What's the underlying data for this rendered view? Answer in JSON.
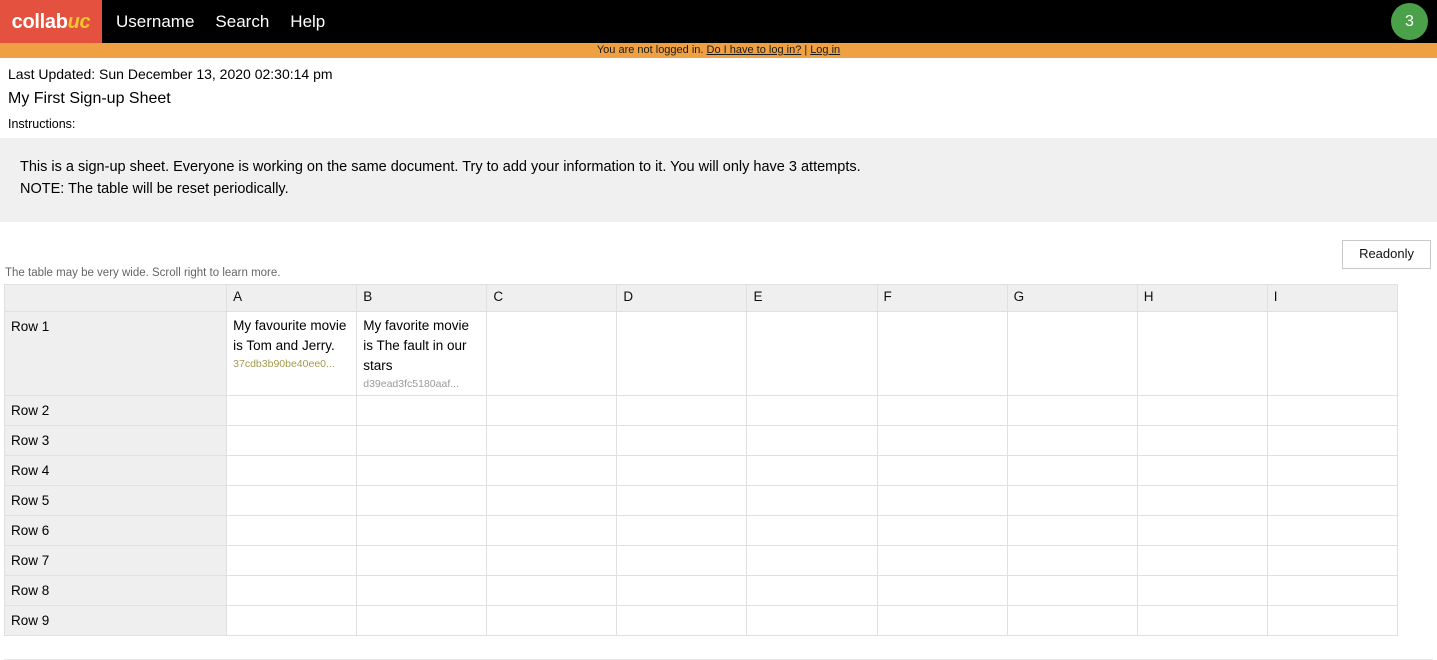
{
  "navbar": {
    "brand_primary": "collab",
    "brand_accent": "uc",
    "brand_bg": "#e4513f",
    "brand_accent_color": "#f2c430",
    "links": [
      {
        "label": "Username",
        "name": "nav-link-username"
      },
      {
        "label": "Search",
        "name": "nav-link-search"
      },
      {
        "label": "Help",
        "name": "nav-link-help"
      }
    ],
    "attempts_badge": {
      "value": "3",
      "color": "#4aa14a"
    }
  },
  "alert": {
    "message": "You are not logged in.",
    "help_link": "Do I have to log in?",
    "separator": "|",
    "login_link": "Log in",
    "background": "#efa043"
  },
  "header": {
    "last_updated": "Last Updated: Sun December 13, 2020 02:30:14 pm",
    "sheet_title": "My First Sign-up Sheet",
    "instructions_label": "Instructions:"
  },
  "instructions": {
    "line1": "This is a sign-up sheet. Everyone is working on the same document. Try to add your information to it. You will only have 3 attempts.",
    "line2": "NOTE: The table will be reset periodically."
  },
  "toolbar": {
    "readonly_label": "Readonly"
  },
  "table": {
    "scroll_hint": "The table may be very wide. Scroll right to learn more.",
    "corner_label": "",
    "columns": [
      "A",
      "B",
      "C",
      "D",
      "E",
      "F",
      "G",
      "H",
      "I"
    ],
    "rows": [
      {
        "label": "Row 1",
        "cells": [
          {
            "text": "My favourite movie is Tom and Jerry.",
            "hash": "37cdb3b90be40ee0...",
            "highlight": true
          },
          {
            "text": "My favorite movie is The fault in our stars",
            "hash": "d39ead3fc5180aaf...",
            "highlight": false
          },
          {
            "text": "",
            "hash": "",
            "highlight": false
          },
          {
            "text": "",
            "hash": "",
            "highlight": false
          },
          {
            "text": "",
            "hash": "",
            "highlight": false
          },
          {
            "text": "",
            "hash": "",
            "highlight": false
          },
          {
            "text": "",
            "hash": "",
            "highlight": false
          },
          {
            "text": "",
            "hash": "",
            "highlight": false
          },
          {
            "text": "",
            "hash": "",
            "highlight": false
          }
        ]
      },
      {
        "label": "Row 2",
        "cells": [
          {
            "text": "",
            "hash": "",
            "highlight": false
          },
          {
            "text": "",
            "hash": "",
            "highlight": false
          },
          {
            "text": "",
            "hash": "",
            "highlight": false
          },
          {
            "text": "",
            "hash": "",
            "highlight": false
          },
          {
            "text": "",
            "hash": "",
            "highlight": false
          },
          {
            "text": "",
            "hash": "",
            "highlight": false
          },
          {
            "text": "",
            "hash": "",
            "highlight": false
          },
          {
            "text": "",
            "hash": "",
            "highlight": false
          },
          {
            "text": "",
            "hash": "",
            "highlight": false
          }
        ]
      },
      {
        "label": "Row 3",
        "cells": [
          {
            "text": "",
            "hash": "",
            "highlight": false
          },
          {
            "text": "",
            "hash": "",
            "highlight": false
          },
          {
            "text": "",
            "hash": "",
            "highlight": false
          },
          {
            "text": "",
            "hash": "",
            "highlight": false
          },
          {
            "text": "",
            "hash": "",
            "highlight": false
          },
          {
            "text": "",
            "hash": "",
            "highlight": false
          },
          {
            "text": "",
            "hash": "",
            "highlight": false
          },
          {
            "text": "",
            "hash": "",
            "highlight": false
          },
          {
            "text": "",
            "hash": "",
            "highlight": false
          }
        ]
      },
      {
        "label": "Row 4",
        "cells": [
          {
            "text": "",
            "hash": "",
            "highlight": false
          },
          {
            "text": "",
            "hash": "",
            "highlight": false
          },
          {
            "text": "",
            "hash": "",
            "highlight": false
          },
          {
            "text": "",
            "hash": "",
            "highlight": false
          },
          {
            "text": "",
            "hash": "",
            "highlight": false
          },
          {
            "text": "",
            "hash": "",
            "highlight": false
          },
          {
            "text": "",
            "hash": "",
            "highlight": false
          },
          {
            "text": "",
            "hash": "",
            "highlight": false
          },
          {
            "text": "",
            "hash": "",
            "highlight": false
          }
        ]
      },
      {
        "label": "Row 5",
        "cells": [
          {
            "text": "",
            "hash": "",
            "highlight": false
          },
          {
            "text": "",
            "hash": "",
            "highlight": false
          },
          {
            "text": "",
            "hash": "",
            "highlight": false
          },
          {
            "text": "",
            "hash": "",
            "highlight": false
          },
          {
            "text": "",
            "hash": "",
            "highlight": false
          },
          {
            "text": "",
            "hash": "",
            "highlight": false
          },
          {
            "text": "",
            "hash": "",
            "highlight": false
          },
          {
            "text": "",
            "hash": "",
            "highlight": false
          },
          {
            "text": "",
            "hash": "",
            "highlight": false
          }
        ]
      },
      {
        "label": "Row 6",
        "cells": [
          {
            "text": "",
            "hash": "",
            "highlight": false
          },
          {
            "text": "",
            "hash": "",
            "highlight": false
          },
          {
            "text": "",
            "hash": "",
            "highlight": false
          },
          {
            "text": "",
            "hash": "",
            "highlight": false
          },
          {
            "text": "",
            "hash": "",
            "highlight": false
          },
          {
            "text": "",
            "hash": "",
            "highlight": false
          },
          {
            "text": "",
            "hash": "",
            "highlight": false
          },
          {
            "text": "",
            "hash": "",
            "highlight": false
          },
          {
            "text": "",
            "hash": "",
            "highlight": false
          }
        ]
      },
      {
        "label": "Row 7",
        "cells": [
          {
            "text": "",
            "hash": "",
            "highlight": false
          },
          {
            "text": "",
            "hash": "",
            "highlight": false
          },
          {
            "text": "",
            "hash": "",
            "highlight": false
          },
          {
            "text": "",
            "hash": "",
            "highlight": false
          },
          {
            "text": "",
            "hash": "",
            "highlight": false
          },
          {
            "text": "",
            "hash": "",
            "highlight": false
          },
          {
            "text": "",
            "hash": "",
            "highlight": false
          },
          {
            "text": "",
            "hash": "",
            "highlight": false
          },
          {
            "text": "",
            "hash": "",
            "highlight": false
          }
        ]
      },
      {
        "label": "Row 8",
        "cells": [
          {
            "text": "",
            "hash": "",
            "highlight": false
          },
          {
            "text": "",
            "hash": "",
            "highlight": false
          },
          {
            "text": "",
            "hash": "",
            "highlight": false
          },
          {
            "text": "",
            "hash": "",
            "highlight": false
          },
          {
            "text": "",
            "hash": "",
            "highlight": false
          },
          {
            "text": "",
            "hash": "",
            "highlight": false
          },
          {
            "text": "",
            "hash": "",
            "highlight": false
          },
          {
            "text": "",
            "hash": "",
            "highlight": false
          },
          {
            "text": "",
            "hash": "",
            "highlight": false
          }
        ]
      },
      {
        "label": "Row 9",
        "cells": [
          {
            "text": "",
            "hash": "",
            "highlight": false
          },
          {
            "text": "",
            "hash": "",
            "highlight": false
          },
          {
            "text": "",
            "hash": "",
            "highlight": false
          },
          {
            "text": "",
            "hash": "",
            "highlight": false
          },
          {
            "text": "",
            "hash": "",
            "highlight": false
          },
          {
            "text": "",
            "hash": "",
            "highlight": false
          },
          {
            "text": "",
            "hash": "",
            "highlight": false
          },
          {
            "text": "",
            "hash": "",
            "highlight": false
          },
          {
            "text": "",
            "hash": "",
            "highlight": false
          }
        ]
      }
    ]
  }
}
